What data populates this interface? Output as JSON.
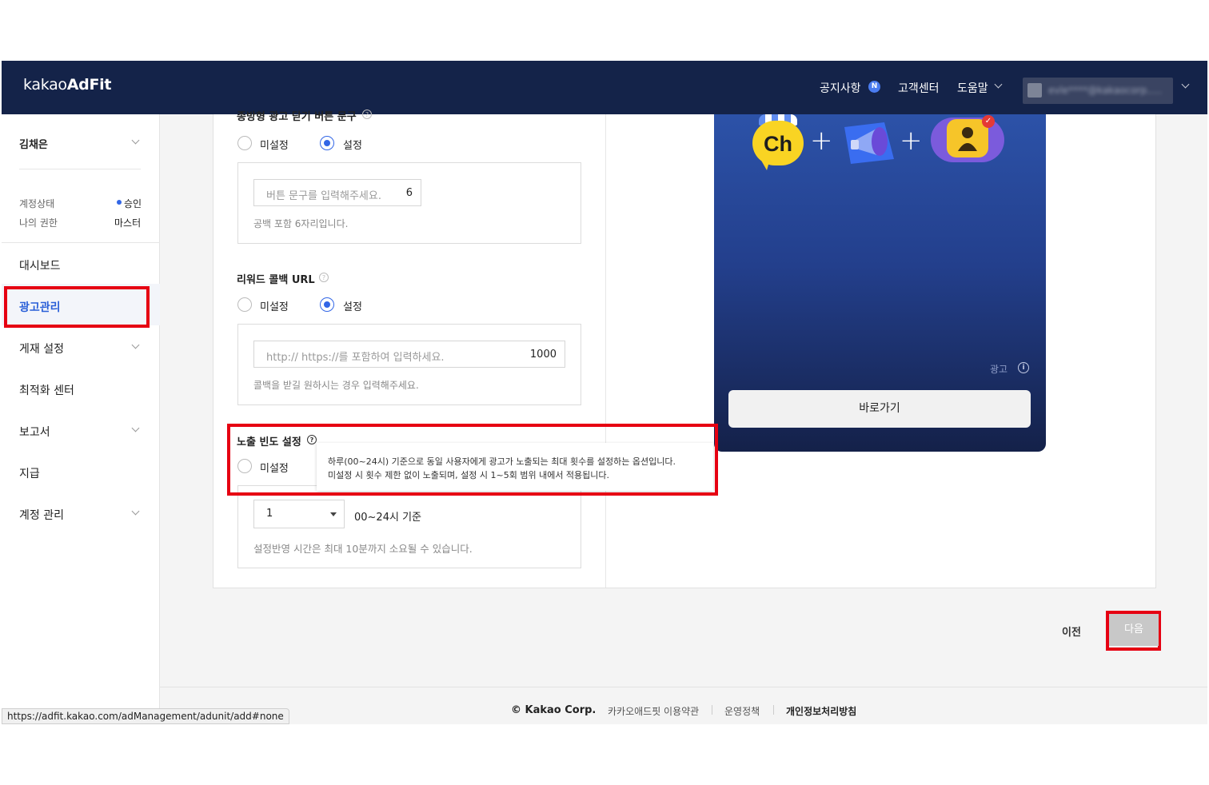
{
  "header": {
    "logo_light": "kakao",
    "logo_bold": "AdFit",
    "nav": {
      "notice": "공지사항",
      "notice_badge": "N",
      "support": "고객센터",
      "help": "도움말"
    },
    "user_email": "evle****@kakaocorp....."
  },
  "sidebar": {
    "user_name": "김채은",
    "account_status_label": "계정상태",
    "account_status_value": "승인",
    "role_label": "나의 권한",
    "role_value": "마스터",
    "menu": [
      {
        "label": "대시보드"
      },
      {
        "label": "광고관리",
        "active": true
      },
      {
        "label": "게재 설정"
      },
      {
        "label": "최적화 센터"
      },
      {
        "label": "보고서"
      },
      {
        "label": "지급"
      },
      {
        "label": "계정 관리"
      }
    ]
  },
  "form": {
    "close_button_text": {
      "label": "종방형 광고 닫기 버튼 문구",
      "option_unset": "미설정",
      "option_set": "설정",
      "placeholder": "버튼 문구를 입력해주세요.",
      "count": "6",
      "help": "공백 포함 6자리입니다."
    },
    "reward_callback": {
      "label": "리워드 콜백 URL",
      "option_unset": "미설정",
      "option_set": "설정",
      "placeholder": "http:// https://를 포함하여 입력하세요.",
      "count": "1000",
      "help": "콜백을 받길 원하시는 경우 입력해주세요."
    },
    "frequency": {
      "label": "노출 빈도 설정",
      "option_unset": "미설정",
      "select_value": "1",
      "unit_text": "00~24시 기준",
      "help": "설정반영 시간은 최대 10분까지 소요될 수 있습니다.",
      "tooltip_line1": "하루(00~24시) 기준으로 동일 사용자에게 광고가 노출되는 최대 횟수를 설정하는 옵션입니다.",
      "tooltip_line2": "미설정 시 횟수 제한 없이 노출되며, 설정 시 1~5회 범위 내에서 적용됩니다."
    }
  },
  "preview": {
    "ch_label": "Ch",
    "ad_tag": "광고",
    "cta": "바로가기"
  },
  "actions": {
    "prev": "이전",
    "next": "다음"
  },
  "footer": {
    "copyright": "© Kakao Corp.",
    "terms": "카카오애드핏 이용약관",
    "policy": "운영정책",
    "privacy": "개인정보처리방침"
  },
  "status_url": "https://adfit.kakao.com/adManagement/adunit/add#none",
  "colors": {
    "header_bg": "#142349",
    "accent": "#3266e6",
    "highlight_red": "#e60012"
  }
}
